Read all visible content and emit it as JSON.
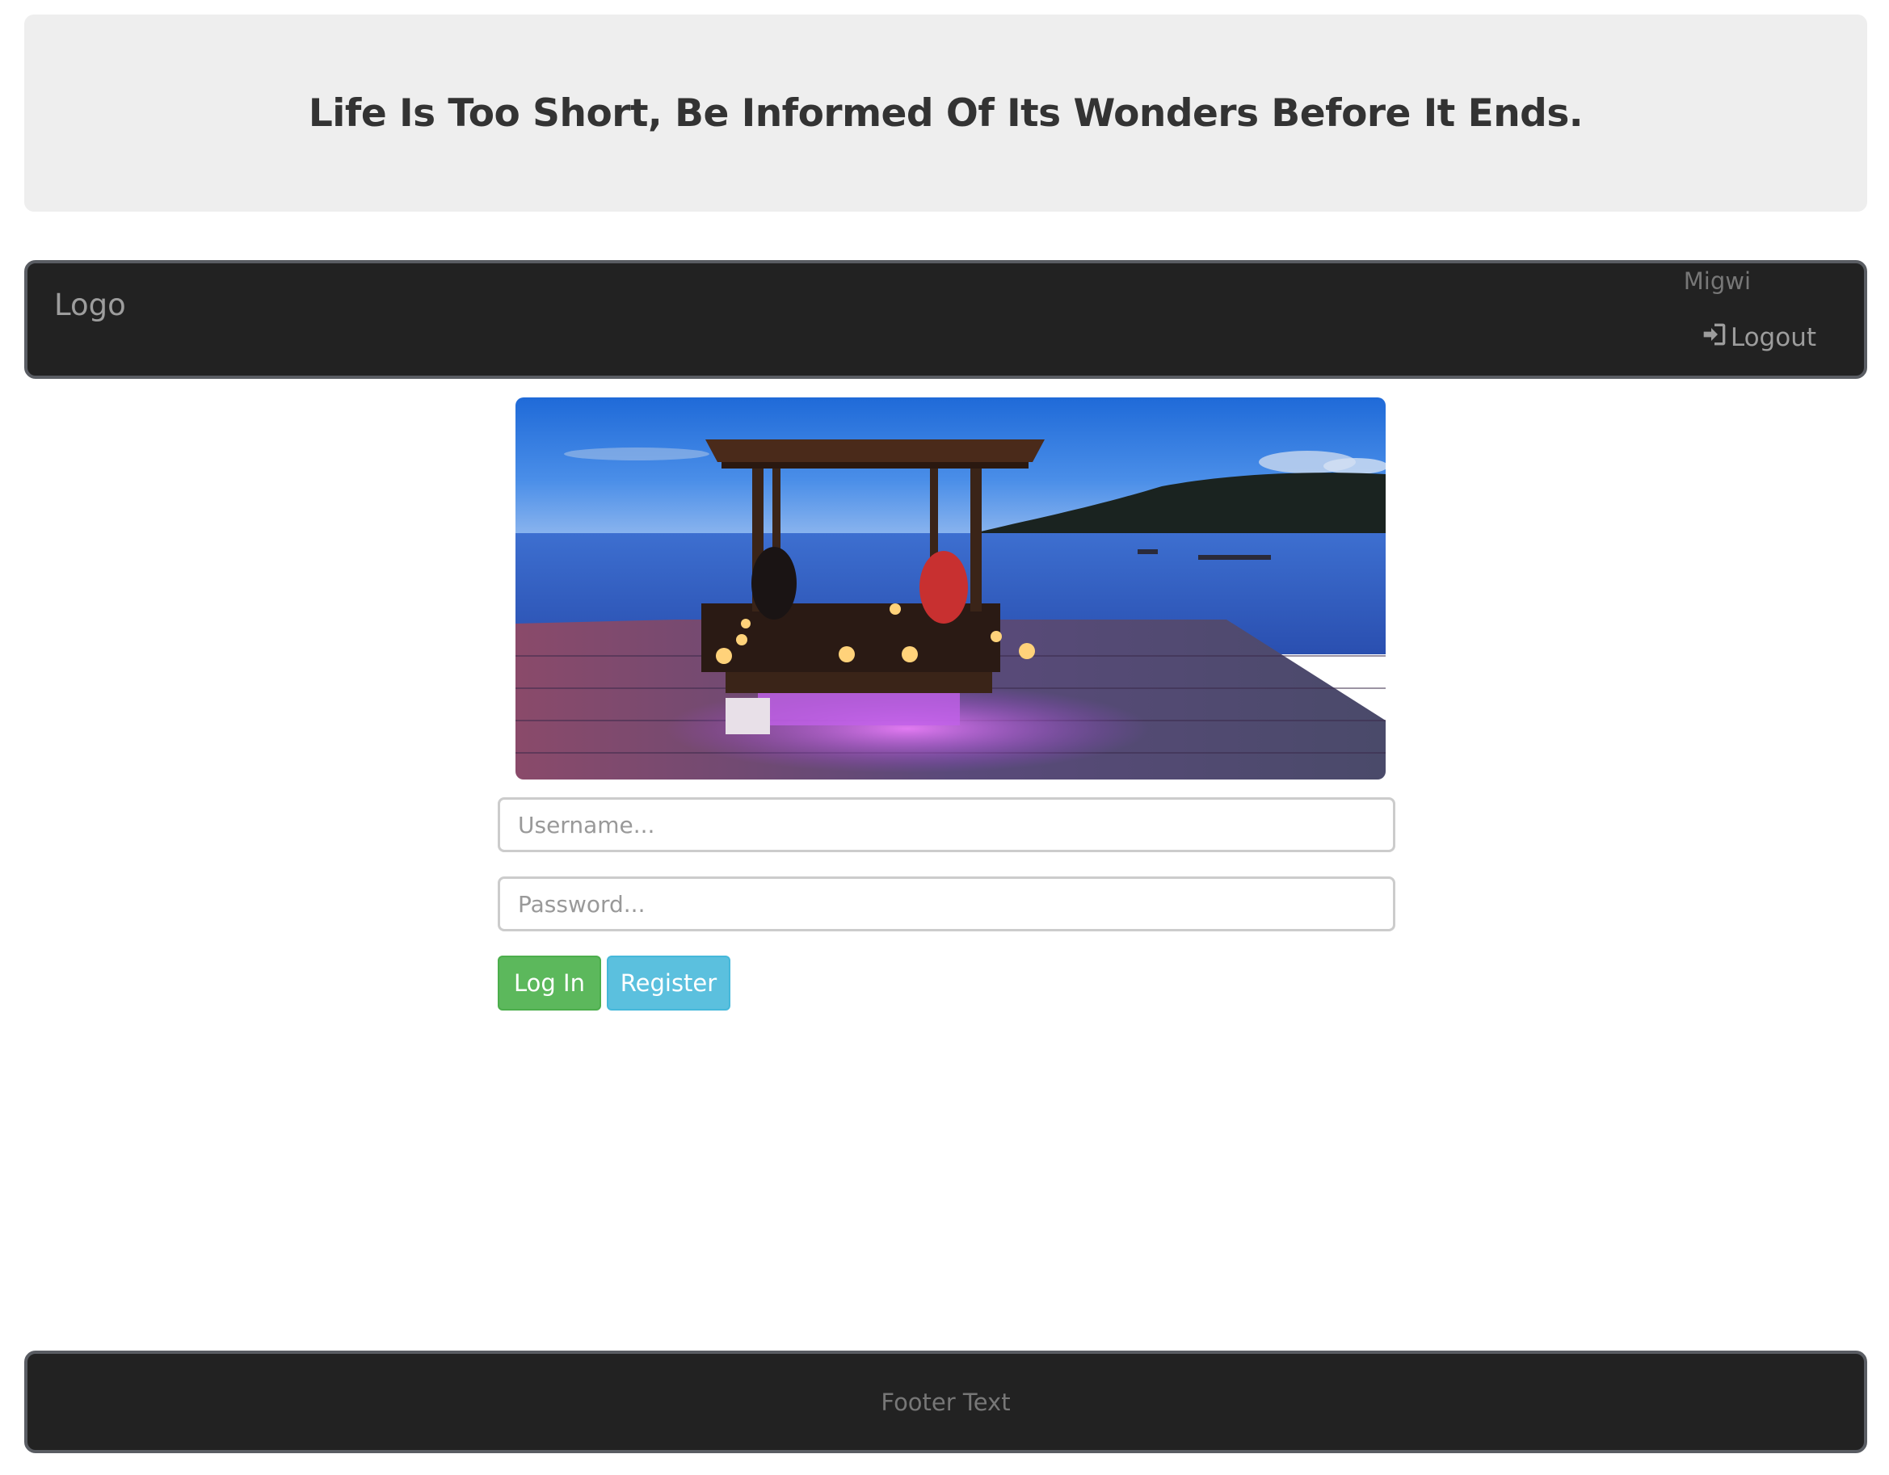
{
  "header": {
    "headline": "Life Is Too Short, Be Informed Of Its Wonders Before It Ends."
  },
  "navbar": {
    "logo": "Logo",
    "username": "Migwi",
    "logout_label": "Logout",
    "logout_icon": "sign-in-icon"
  },
  "hero": {
    "icon": "photo"
  },
  "login_form": {
    "username_placeholder": "Username...",
    "username_value": "",
    "password_placeholder": "Password...",
    "password_value": "",
    "login_label": "Log In",
    "register_label": "Register"
  },
  "footer": {
    "text": "Footer Text"
  },
  "colors": {
    "navbar_bg": "#222222",
    "jumbotron_bg": "#eeeeee",
    "login_button": "#5cb85c",
    "register_button": "#5bc0de"
  }
}
